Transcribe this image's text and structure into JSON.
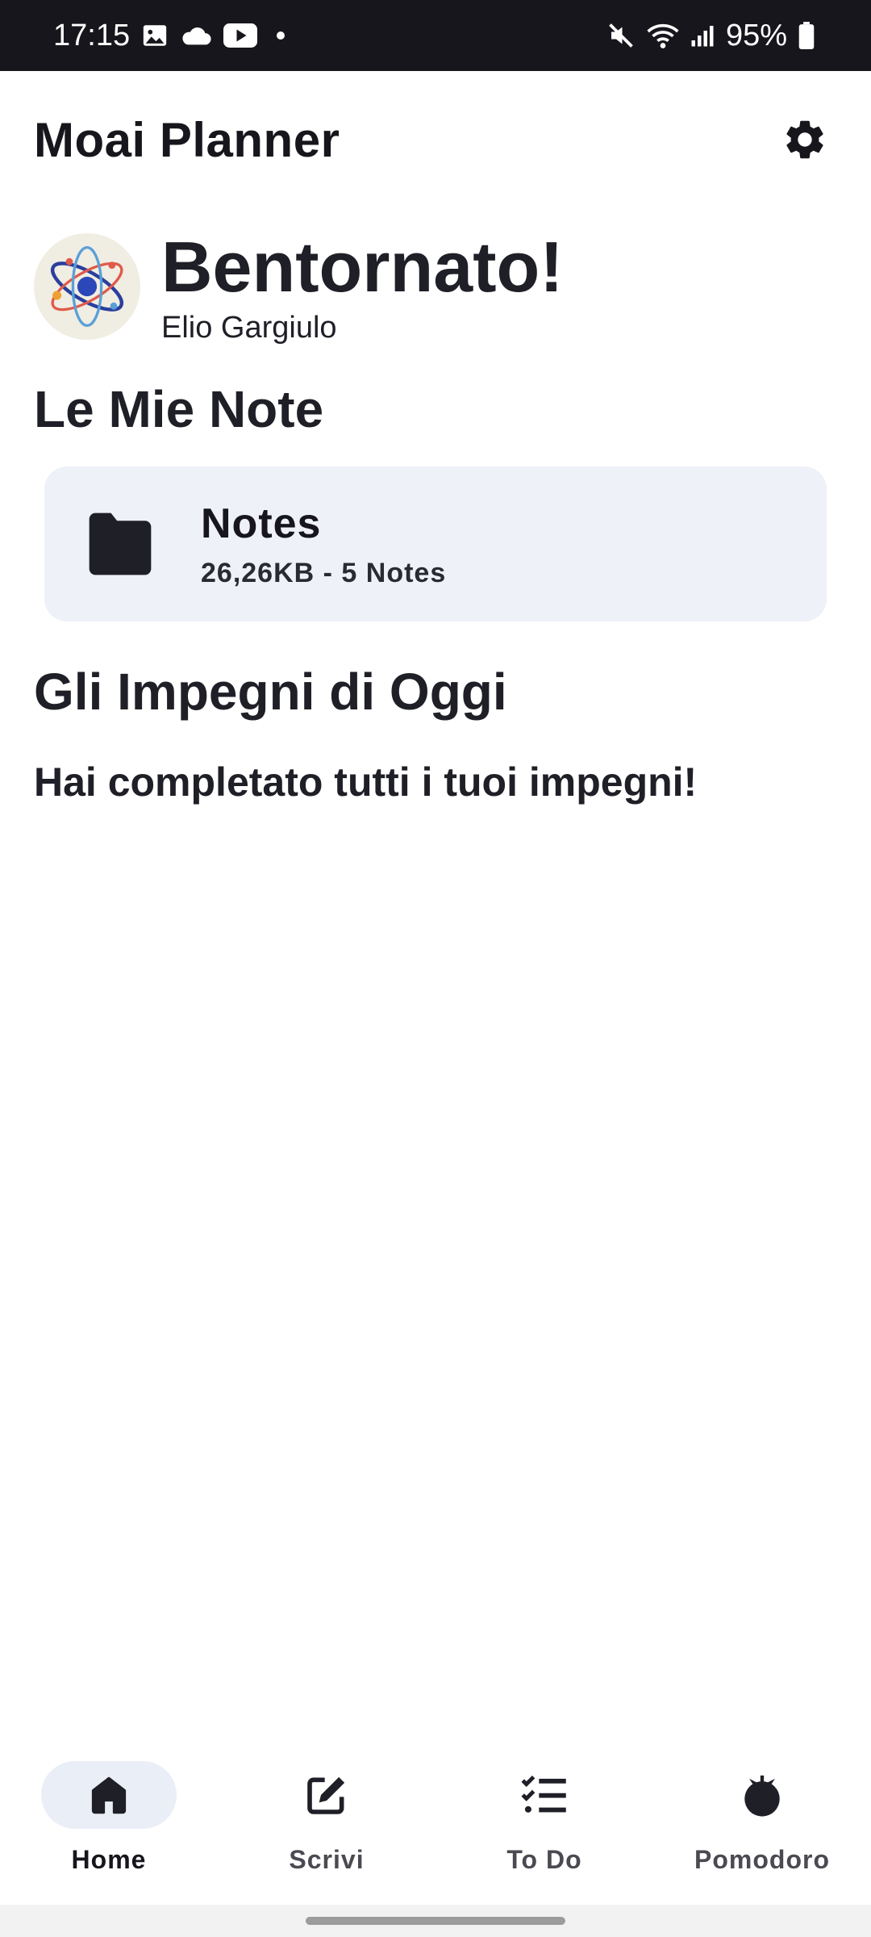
{
  "status_bar": {
    "time": "17:15",
    "left_icons": [
      "gallery-icon",
      "cloud-icon",
      "youtube-icon",
      "dot-icon"
    ],
    "right_icons": [
      "mute-icon",
      "wifi-icon",
      "signal-icon",
      "battery-icon"
    ],
    "battery": "95%"
  },
  "app_bar": {
    "title": "Moai Planner",
    "settings_icon": "gear-icon"
  },
  "welcome": {
    "title": "Bentornato!",
    "user_name": "Elio Gargiulo",
    "avatar_icon": "atom-icon"
  },
  "notes_section": {
    "title": "Le Mie Note",
    "folders": [
      {
        "name": "Notes",
        "meta": "26,26KB - 5 Notes",
        "icon": "folder-icon"
      }
    ]
  },
  "tasks_section": {
    "title": "Gli Impegni di Oggi",
    "empty_message": "Hai completato tutti i tuoi impegni!"
  },
  "bottom_nav": {
    "items": [
      {
        "label": "Home",
        "icon": "home-icon",
        "active": true
      },
      {
        "label": "Scrivi",
        "icon": "edit-icon",
        "active": false
      },
      {
        "label": "To Do",
        "icon": "checklist-icon",
        "active": false
      },
      {
        "label": "Pomodoro",
        "icon": "tomato-icon",
        "active": false
      }
    ]
  },
  "colors": {
    "status_bar_bg": "#16161c",
    "card_bg": "#eef1f8",
    "active_nav_pill": "#eaeef7",
    "text_primary": "#1f1f27"
  }
}
